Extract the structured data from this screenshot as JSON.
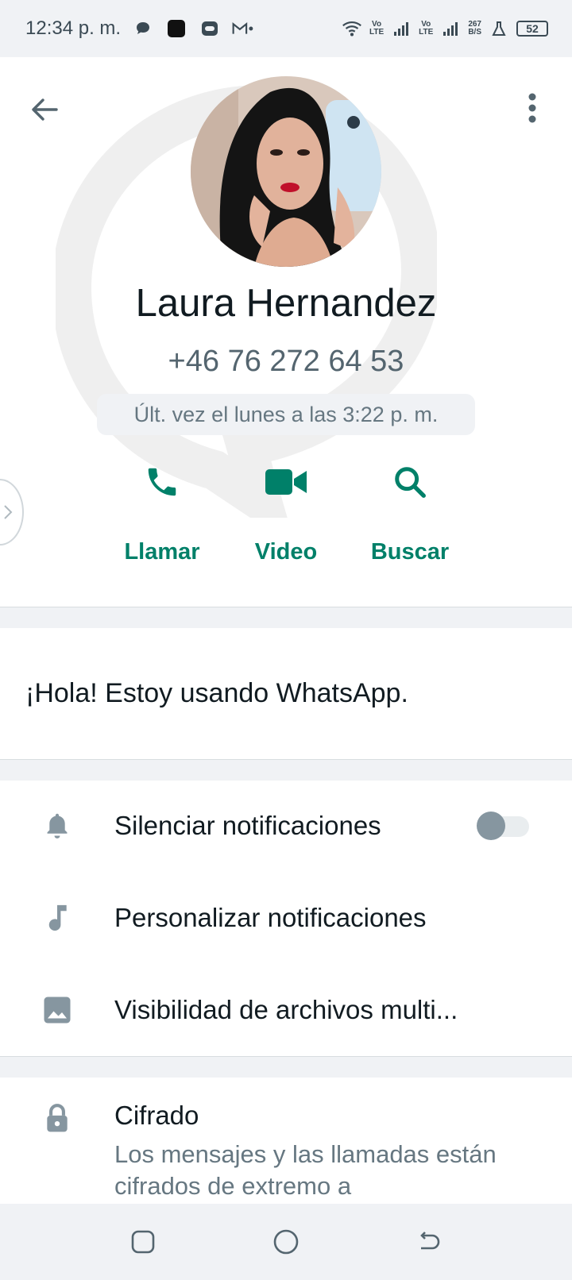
{
  "status_bar": {
    "time": "12:34 p. m.",
    "net_speed_top": "267",
    "net_speed_bottom": "B/S",
    "volte_top": "Vo",
    "volte_bottom": "LTE",
    "battery": "52"
  },
  "contact": {
    "name": "Laura Hernandez",
    "phone": "+46 76 272 64 53",
    "last_seen": "Últ. vez el lunes a las 3:22 p. m."
  },
  "actions": {
    "call_label": "Llamar",
    "video_label": "Video",
    "search_label": "Buscar"
  },
  "about": {
    "text": "¡Hola! Estoy usando WhatsApp."
  },
  "settings": {
    "mute_label": "Silenciar notificaciones",
    "mute_enabled": false,
    "custom_notif_label": "Personalizar notificaciones",
    "media_visibility_label": "Visibilidad de archivos multi..."
  },
  "encryption": {
    "title": "Cifrado",
    "description": "Los mensajes y las llamadas están cifrados de extremo a"
  },
  "colors": {
    "accent": "#008069",
    "background": "#ffffff",
    "section_bg": "#f0f2f5",
    "secondary_text": "#667781",
    "icon_gray": "#8696a0"
  }
}
